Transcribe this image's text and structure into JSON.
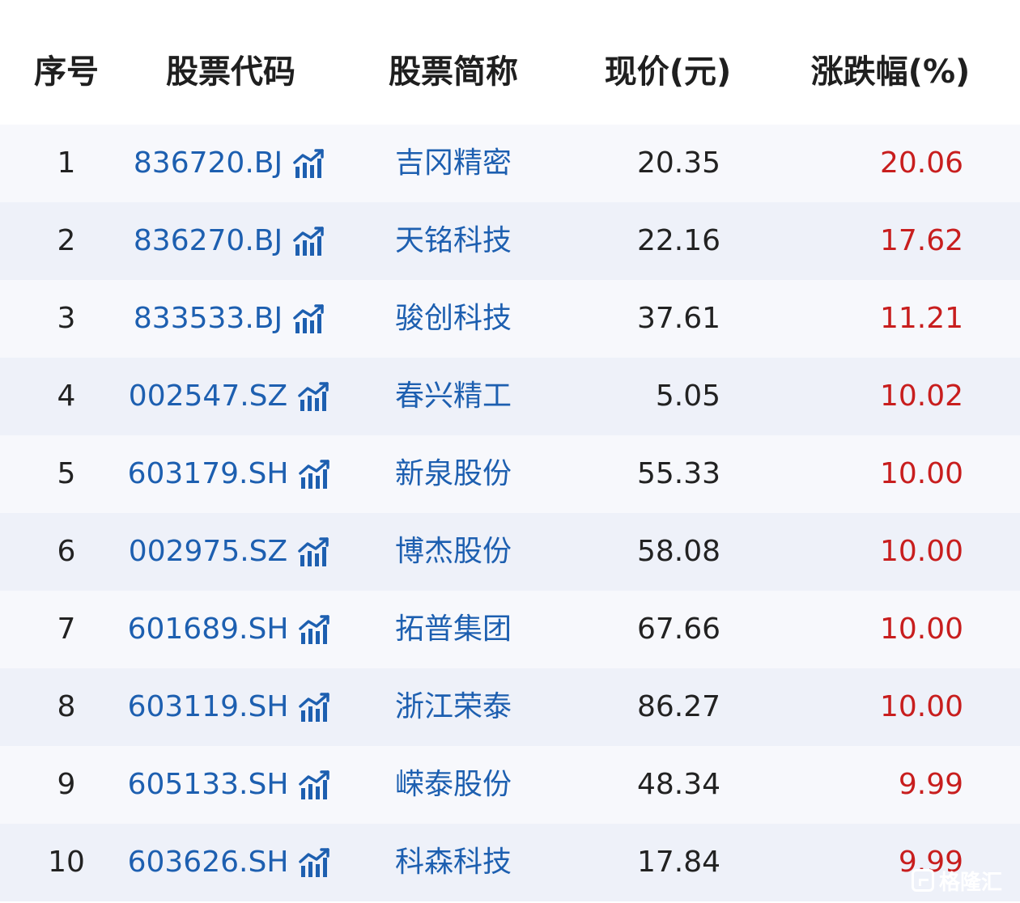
{
  "header": {
    "idx": "序号",
    "code": "股票代码",
    "name": "股票简称",
    "price": "现价(元)",
    "change": "涨跌幅(%)"
  },
  "rows": [
    {
      "idx": "1",
      "code": "836720.BJ",
      "name": "吉冈精密",
      "price": "20.35",
      "change": "20.06"
    },
    {
      "idx": "2",
      "code": "836270.BJ",
      "name": "天铭科技",
      "price": "22.16",
      "change": "17.62"
    },
    {
      "idx": "3",
      "code": "833533.BJ",
      "name": "骏创科技",
      "price": "37.61",
      "change": "11.21"
    },
    {
      "idx": "4",
      "code": "002547.SZ",
      "name": "春兴精工",
      "price": "5.05",
      "change": "10.02"
    },
    {
      "idx": "5",
      "code": "603179.SH",
      "name": "新泉股份",
      "price": "55.33",
      "change": "10.00"
    },
    {
      "idx": "6",
      "code": "002975.SZ",
      "name": "博杰股份",
      "price": "58.08",
      "change": "10.00"
    },
    {
      "idx": "7",
      "code": "601689.SH",
      "name": "拓普集团",
      "price": "67.66",
      "change": "10.00"
    },
    {
      "idx": "8",
      "code": "603119.SH",
      "name": "浙江荣泰",
      "price": "86.27",
      "change": "10.00"
    },
    {
      "idx": "9",
      "code": "605133.SH",
      "name": "嵘泰股份",
      "price": "48.34",
      "change": "9.99"
    },
    {
      "idx": "10",
      "code": "603626.SH",
      "name": "科森科技",
      "price": "17.84",
      "change": "9.99"
    }
  ],
  "icons": {
    "code_row_icon": "stock-chart-icon",
    "watermark_logo": "gelonghui-logo-icon"
  },
  "colors": {
    "code_text": "#1d5fb0",
    "change_up": "#c81e1e",
    "row_odd_bg": "#f7f8fc",
    "row_even_bg": "#eef1f9"
  },
  "watermark": {
    "text": "格隆汇"
  }
}
